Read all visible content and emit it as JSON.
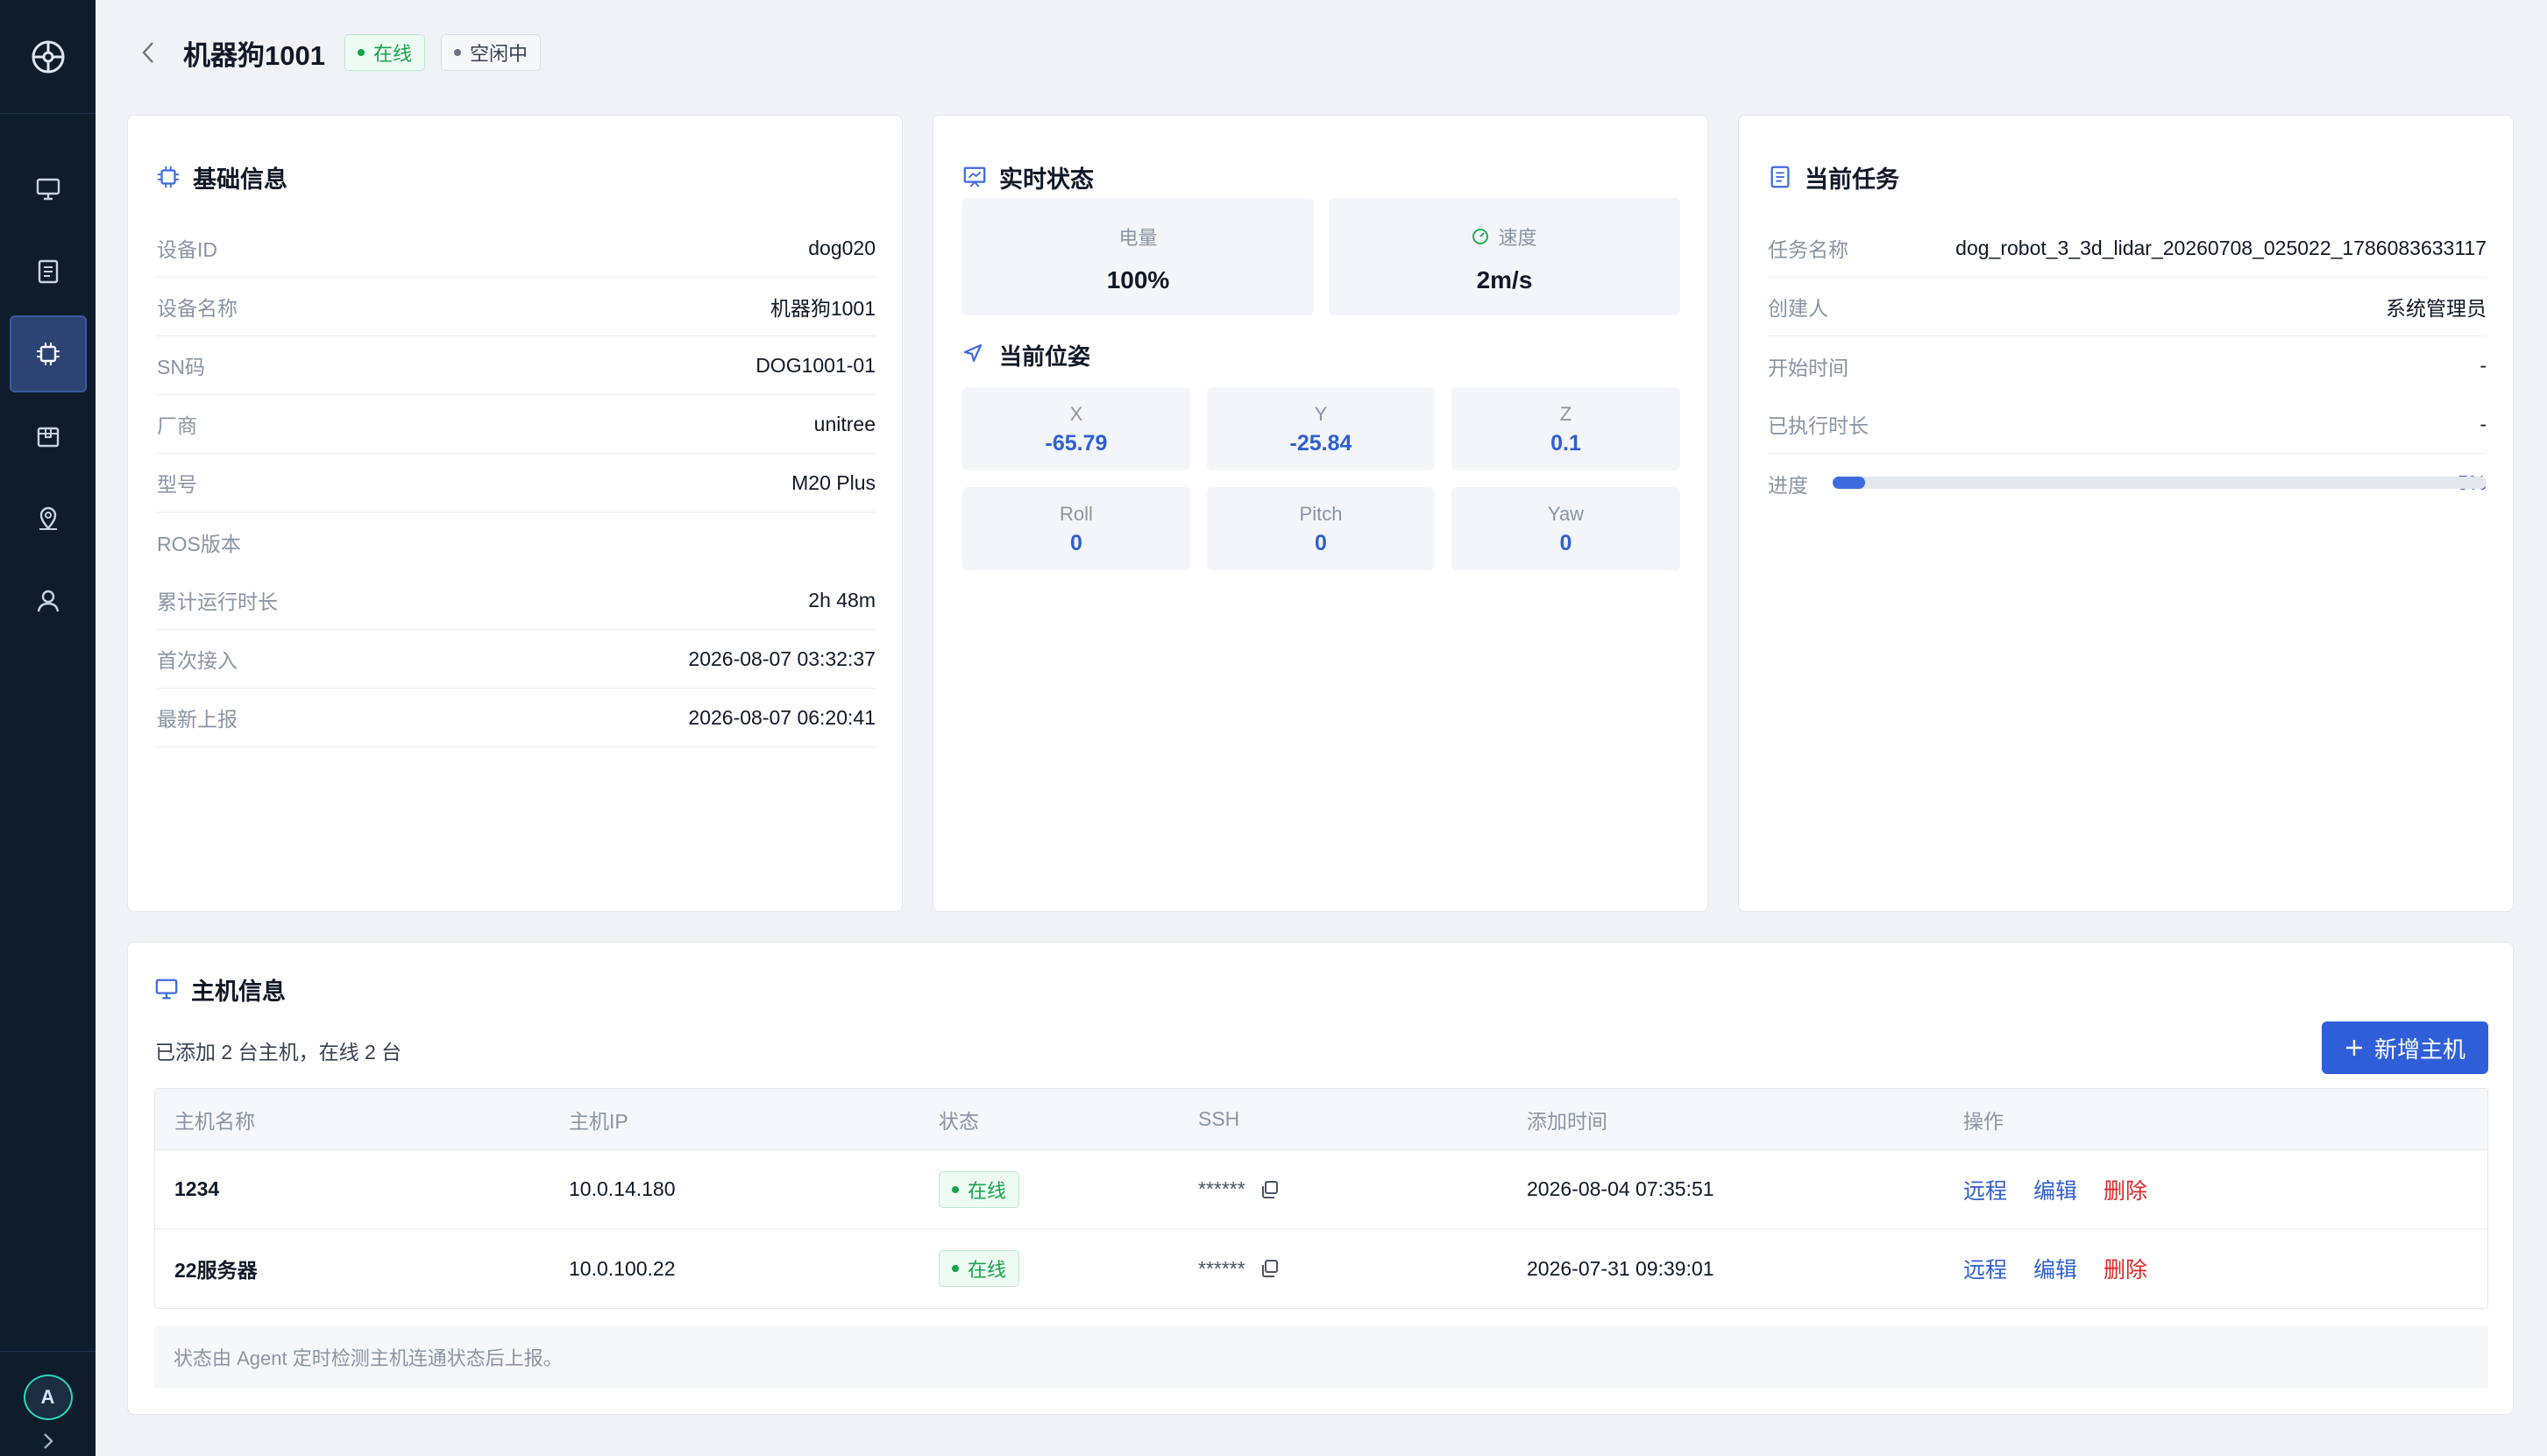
{
  "header": {
    "title": "机器狗1001",
    "status_online": "在线",
    "status_idle": "空闲中"
  },
  "sidebar": {
    "items": [
      {
        "icon": "monitor-icon"
      },
      {
        "icon": "document-icon"
      },
      {
        "icon": "chip-icon",
        "active": true
      },
      {
        "icon": "box-icon"
      },
      {
        "icon": "map-pin-icon"
      },
      {
        "icon": "user-icon"
      }
    ],
    "avatar": "A"
  },
  "basic_info": {
    "title": "基础信息",
    "rows": [
      {
        "label": "设备ID",
        "value": "dog020"
      },
      {
        "label": "设备名称",
        "value": "机器狗1001"
      },
      {
        "label": "SN码",
        "value": "DOG1001-01"
      },
      {
        "label": "厂商",
        "value": "unitree"
      },
      {
        "label": "型号",
        "value": "M20 Plus"
      },
      {
        "label": "ROS版本",
        "value": ""
      },
      {
        "label": "累计运行时长",
        "value": "2h 48m"
      },
      {
        "label": "首次接入",
        "value": "2026-08-07 03:32:37"
      },
      {
        "label": "最新上报",
        "value": "2026-08-07 06:20:41"
      }
    ]
  },
  "realtime": {
    "title": "实时状态",
    "battery_label": "电量",
    "battery_value": "100%",
    "speed_label": "速度",
    "speed_value": "2m/s",
    "pose_title": "当前位姿",
    "pose": [
      {
        "label": "X",
        "value": "-65.79"
      },
      {
        "label": "Y",
        "value": "-25.84"
      },
      {
        "label": "Z",
        "value": "0.1"
      },
      {
        "label": "Roll",
        "value": "0"
      },
      {
        "label": "Pitch",
        "value": "0"
      },
      {
        "label": "Yaw",
        "value": "0"
      }
    ]
  },
  "task": {
    "title": "当前任务",
    "rows": [
      {
        "label": "任务名称",
        "value": "dog_robot_3_3d_lidar_20260708_025022_1786083633117"
      },
      {
        "label": "创建人",
        "value": "系统管理员"
      },
      {
        "label": "开始时间",
        "value": "-"
      },
      {
        "label": "已执行时长",
        "value": "-"
      }
    ],
    "progress_label": "进度",
    "progress_text": "5%",
    "progress_fraction": 0.05
  },
  "hosts": {
    "title": "主机信息",
    "summary": "已添加 2 台主机，在线 2 台",
    "add_button": "新增主机",
    "columns": [
      "主机名称",
      "主机IP",
      "状态",
      "SSH",
      "添加时间",
      "操作"
    ],
    "rows": [
      {
        "name": "1234",
        "ip": "10.0.14.180",
        "status": "在线",
        "ssh": "******",
        "added": "2026-08-04 07:35:51"
      },
      {
        "name": "22服务器",
        "ip": "10.0.100.22",
        "status": "在线",
        "ssh": "******",
        "added": "2026-07-31 09:39:01"
      }
    ],
    "actions": {
      "remote": "远程",
      "edit": "编辑",
      "delete": "删除"
    },
    "note": "状态由 Agent 定时检测主机连通状态后上报。"
  },
  "colors": {
    "sidebar_bg": "#0f1c2c",
    "accent": "#2f5fd8",
    "online": "#16a34a",
    "danger": "#dc2626"
  }
}
